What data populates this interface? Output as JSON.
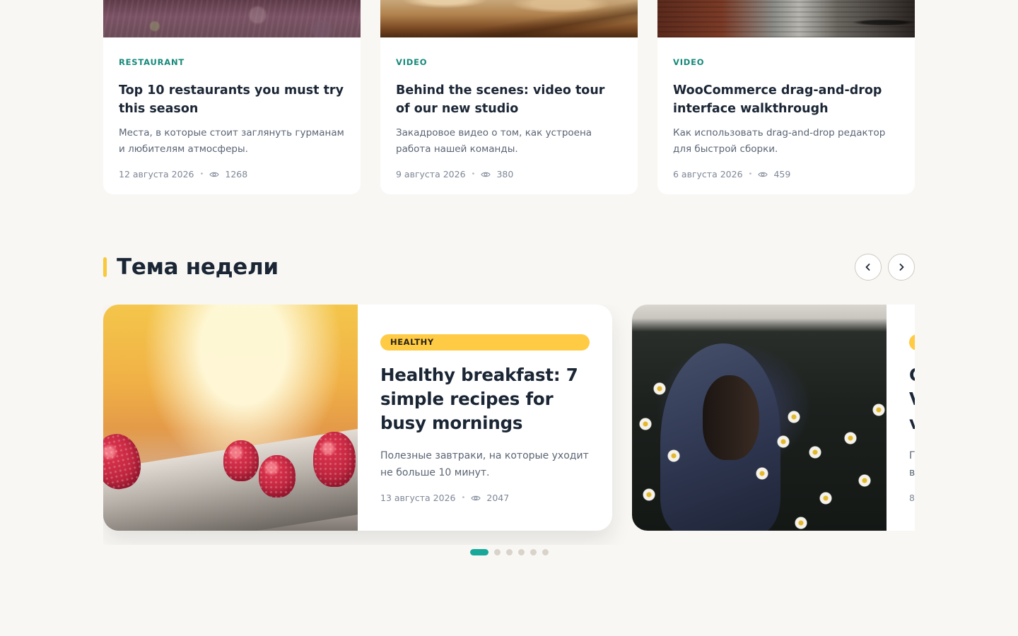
{
  "top_posts": [
    {
      "category": "RESTAURANT",
      "title": "Top 10 restaurants you must try this season",
      "excerpt": "Места, в которые стоит заглянуть гурманам и любителям атмосферы.",
      "date": "12 августа 2026",
      "views": "1268",
      "image": "restaurant-photo"
    },
    {
      "category": "VIDEO",
      "title": "Behind the scenes: video tour of our new studio",
      "excerpt": "Закадровое видео о том, как устроена работа нашей команды.",
      "date": "9 августа 2026",
      "views": "380",
      "image": "desert-hills-photo"
    },
    {
      "category": "VIDEO",
      "title": "WooCommerce drag-and-drop interface walkthrough",
      "excerpt": "Как использовать drag-and-drop редактор для быстрой сборки.",
      "date": "6 августа 2026",
      "views": "459",
      "image": "alley-photo"
    }
  ],
  "section": {
    "title": "Тема недели",
    "accent_color": "#f8c93c"
  },
  "nav": {
    "prev_icon": "chevron-left-icon",
    "next_icon": "chevron-right-icon"
  },
  "slides": [
    {
      "badge": "HEALTHY",
      "title": "Healthy breakfast: 7 simple recipes for busy mornings",
      "excerpt": "Полезные завтраки, на которые уходит не больше 10 минут.",
      "date": "13 августа 2026",
      "views": "2047",
      "image": "raspberries-photo"
    },
    {
      "image": "hooded-person-in-daisies-photo",
      "title_visible_fragment": [
        "C",
        "V",
        "v"
      ],
      "excerpt_visible_fragment": [
        "Г",
        "в"
      ],
      "date_visible_fragment": "8"
    }
  ],
  "pagination": {
    "total": 6,
    "active": 1,
    "active_color": "#17a89a"
  },
  "colors": {
    "background": "#f8f7f4",
    "category_teal": "#16897a",
    "badge_yellow": "#ffcb44",
    "heading": "#1b2635"
  }
}
